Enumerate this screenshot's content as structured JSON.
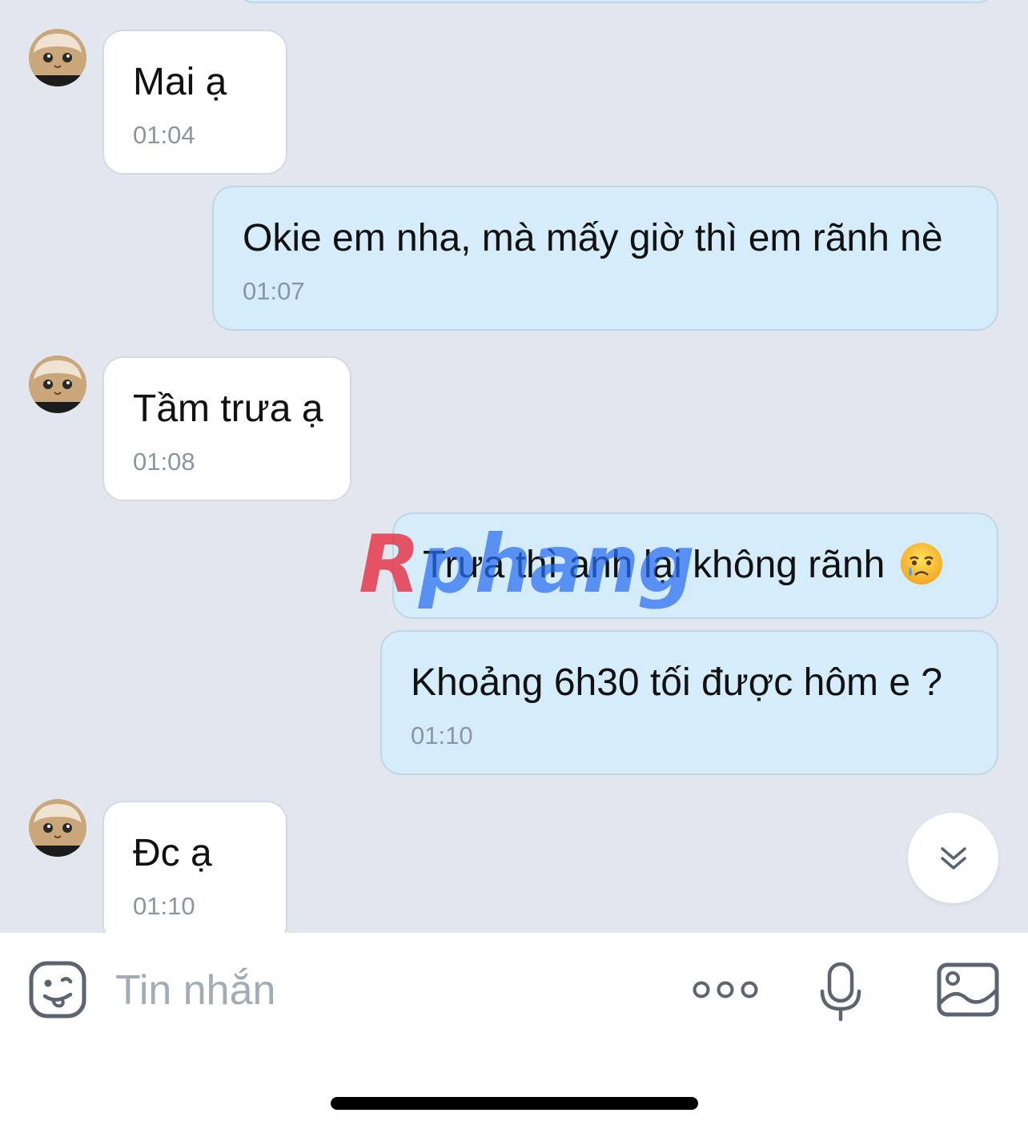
{
  "composer": {
    "placeholder": "Tin nhắn",
    "icons": [
      "sticker-icon",
      "more-dots-icon",
      "microphone-icon",
      "image-icon"
    ]
  },
  "watermark": {
    "part1": "R",
    "part2": "phang"
  },
  "messages": [
    {
      "direction": "incoming",
      "text": "Mai ạ",
      "time": "01:04",
      "avatar": "cat-avatar"
    },
    {
      "direction": "outgoing",
      "text": "Okie em nha, mà mấy giờ thì em rãnh nè",
      "time": "01:07"
    },
    {
      "direction": "incoming",
      "text": "Tầm trưa ạ",
      "time": "01:08",
      "avatar": "cat-avatar"
    },
    {
      "direction": "outgoing",
      "text": "Trưa thì anh lại không rãnh",
      "emoji": "crying-face-emoji"
    },
    {
      "direction": "outgoing",
      "text": "Khoảng 6h30 tối được hôm e ?",
      "time": "01:10"
    },
    {
      "direction": "incoming",
      "text": "Đc ạ",
      "time": "01:10",
      "avatar": "cat-avatar"
    }
  ],
  "colors": {
    "background": "#e2e7ef",
    "incoming_bubble": "#ffffff",
    "outgoing_bubble": "#d5ecfb",
    "timestamp": "#8b96a2"
  }
}
